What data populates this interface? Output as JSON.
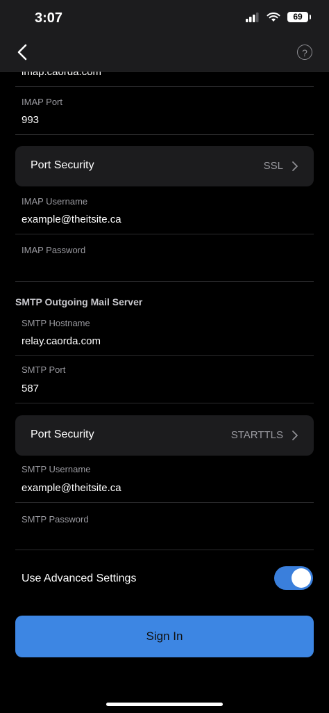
{
  "status_bar": {
    "time": "3:07",
    "battery": "69"
  },
  "nav": {
    "back_icon": "chevron-left-icon",
    "help_label": "?"
  },
  "imap": {
    "hostname_value": "imap.caorda.com",
    "port_label": "IMAP Port",
    "port_value": "993",
    "security_label": "Port Security",
    "security_value": "SSL",
    "username_label": "IMAP Username",
    "username_value": "example@theitsite.ca",
    "password_label": "IMAP Password",
    "password_value": ""
  },
  "smtp": {
    "section_title": "SMTP Outgoing Mail Server",
    "hostname_label": "SMTP Hostname",
    "hostname_value": "relay.caorda.com",
    "port_label": "SMTP Port",
    "port_value": "587",
    "security_label": "Port Security",
    "security_value": "STARTTLS",
    "username_label": "SMTP Username",
    "username_value": "example@theitsite.ca",
    "password_label": "SMTP Password",
    "password_value": ""
  },
  "advanced": {
    "label": "Use Advanced Settings",
    "enabled": true
  },
  "signin_label": "Sign In",
  "colors": {
    "accent": "#3d86e3",
    "toggle_on": "#3a7fdc",
    "background": "#000000",
    "card": "#1c1c1e"
  }
}
